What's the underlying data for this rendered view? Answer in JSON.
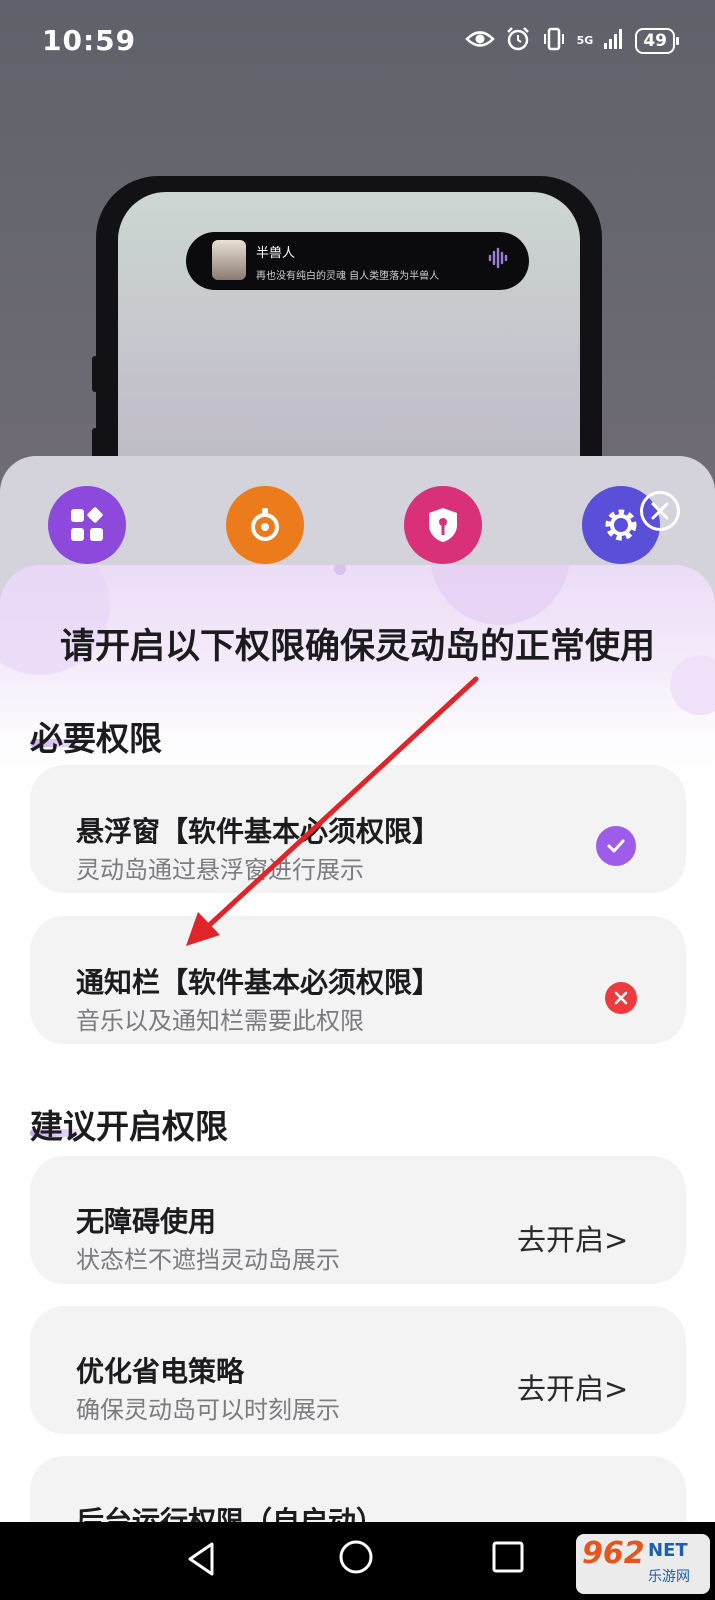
{
  "status_bar": {
    "time": "10:59",
    "network": "5G",
    "battery": "49",
    "icons": [
      "eye-icon",
      "alarm-icon",
      "vibrate-icon",
      "signal-icon",
      "battery-icon"
    ]
  },
  "phone_preview": {
    "island_title": "半兽人",
    "island_subtitle": "再也没有纯白的灵魂 自人类堕落为半兽人"
  },
  "feature_icons": [
    "apps-icon",
    "camera-icon",
    "key-shield-icon",
    "gear-icon"
  ],
  "modal": {
    "title": "请开启以下权限确保灵动岛的正常使用",
    "required_section": {
      "title": "必要权限",
      "items": [
        {
          "title": "悬浮窗【软件基本必须权限】",
          "subtitle": "灵动岛通过悬浮窗进行展示",
          "status": "granted"
        },
        {
          "title": "通知栏【软件基本必须权限】",
          "subtitle": "音乐以及通知栏需要此权限",
          "status": "denied"
        }
      ]
    },
    "suggested_section": {
      "title": "建议开启权限",
      "items": [
        {
          "title": "无障碍使用",
          "subtitle": "状态栏不遮挡灵动岛展示",
          "action": "去开启>"
        },
        {
          "title": "优化省电策略",
          "subtitle": "确保灵动岛可以时刻展示",
          "action": "去开启>"
        },
        {
          "title": "后台运行权限（自启动）",
          "subtitle": "",
          "action": ""
        }
      ]
    }
  },
  "colors": {
    "accent_purple": "#9d5ce9",
    "error_red": "#ec3b3f",
    "annotation_arrow": "#e0252a"
  },
  "watermark": {
    "brand": "962",
    "suffix": "NET",
    "sub": "乐游网"
  }
}
